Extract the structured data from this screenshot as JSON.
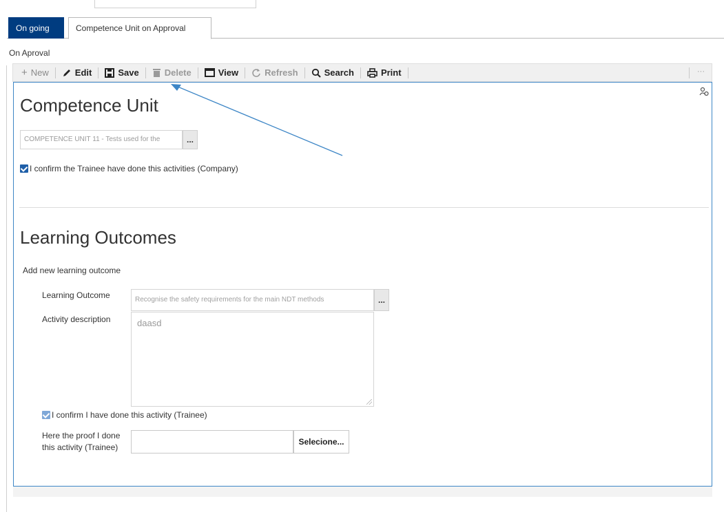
{
  "tabs": [
    {
      "label": "On going",
      "active": true
    },
    {
      "label": "Competence Unit on Approval",
      "active": false
    }
  ],
  "section_label": "On Aproval",
  "toolbar": {
    "new": "New",
    "edit": "Edit",
    "save": "Save",
    "delete": "Delete",
    "view": "View",
    "refresh": "Refresh",
    "search": "Search",
    "print": "Print",
    "more": "···"
  },
  "competence_unit": {
    "heading": "Competence Unit",
    "field_value": "COMPETENCE UNIT 11 - Tests used for the",
    "lookup_button": "...",
    "confirm_company": "I confirm the Trainee have done this activities (Company)"
  },
  "learning_outcomes": {
    "heading": "Learning Outcomes",
    "add_new": "Add new learning outcome",
    "lo_label": "Learning Outcome",
    "lo_value": "Recognise the safety requirements for the main NDT methods",
    "lo_button": "...",
    "activity_label": "Activity description",
    "activity_value": "daasd",
    "confirm_trainee": "I confirm I have done this activity (Trainee)",
    "proof_label_line1": "Here the proof I done",
    "proof_label_line2": "this activity (Trainee)",
    "file_button": "Selecione..."
  },
  "colors": {
    "active_tab": "#003c80",
    "panel_border": "#3d86c6",
    "annotation_arrow": "#3d86c6"
  }
}
